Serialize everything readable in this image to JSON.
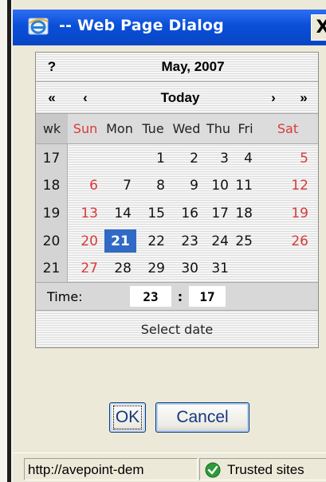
{
  "window": {
    "title": "-- Web Page Dialog",
    "close_label": "X"
  },
  "calendar": {
    "help_label": "?",
    "month_year": "May, 2007",
    "nav": {
      "prev_year": "«",
      "prev_month": "‹",
      "today": "Today",
      "next_month": "›",
      "next_year": "»"
    },
    "weekday_headers": [
      "wk",
      "Sun",
      "Mon",
      "Tue",
      "Wed",
      "Thu",
      "Fri",
      "Sat"
    ],
    "weeks": [
      {
        "wk": "17",
        "days": [
          "",
          "",
          "1",
          "2",
          "3",
          "4",
          "5"
        ]
      },
      {
        "wk": "18",
        "days": [
          "6",
          "7",
          "8",
          "9",
          "10",
          "11",
          "12"
        ]
      },
      {
        "wk": "19",
        "days": [
          "13",
          "14",
          "15",
          "16",
          "17",
          "18",
          "19"
        ]
      },
      {
        "wk": "20",
        "days": [
          "20",
          "21",
          "22",
          "23",
          "24",
          "25",
          "26"
        ]
      },
      {
        "wk": "21",
        "days": [
          "27",
          "28",
          "29",
          "30",
          "31",
          "",
          ""
        ]
      }
    ],
    "selected_day": "21",
    "time": {
      "label": "Time:",
      "hour": "23",
      "separator": ":",
      "minute": "17"
    },
    "footer_label": "Select date"
  },
  "buttons": {
    "ok_label": "OK",
    "cancel_label": "Cancel"
  },
  "statusbar": {
    "url": "http://avepoint-dem",
    "zone_label": "Trusted sites"
  },
  "colors": {
    "weekend": "#d83a3a",
    "selected_bg": "#316ac5",
    "title_bar": "#0a4fd8"
  },
  "icons": {
    "title": "ie-icon",
    "zone": "trusted-sites-check-icon"
  }
}
